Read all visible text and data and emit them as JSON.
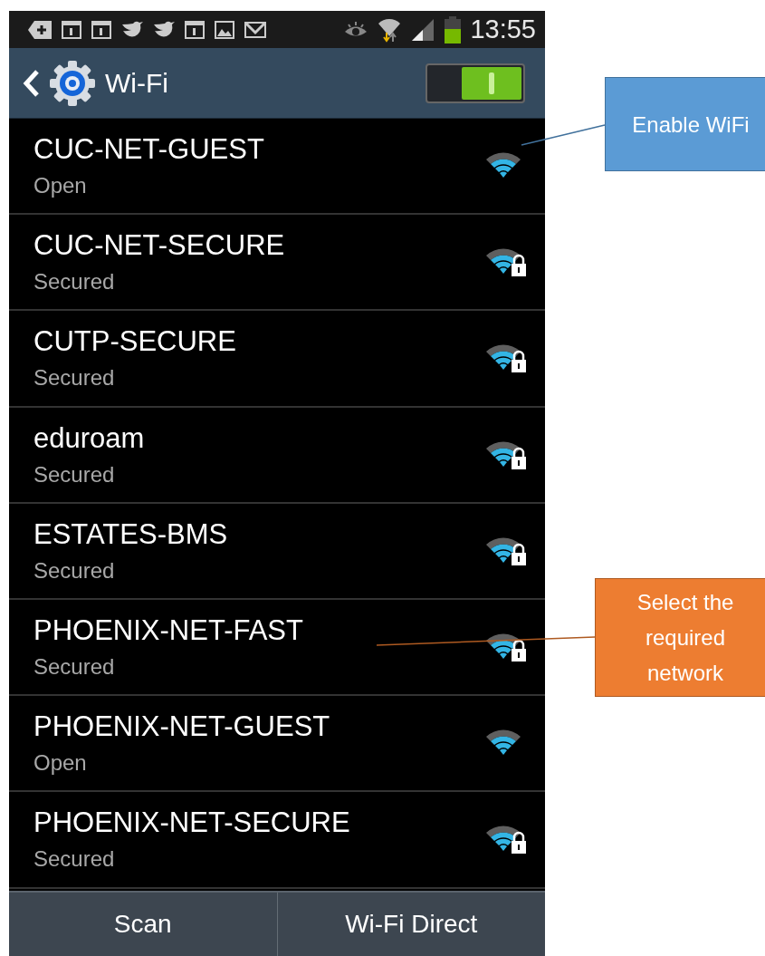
{
  "status_bar": {
    "time": "13:55"
  },
  "header": {
    "title": "Wi-Fi",
    "wifi_switch": {
      "on": true
    }
  },
  "networks": [
    {
      "name": "CUC-NET-GUEST",
      "security": "Open",
      "kind": "open"
    },
    {
      "name": "CUC-NET-SECURE",
      "security": "Secured",
      "kind": "locked"
    },
    {
      "name": "CUTP-SECURE",
      "security": "Secured",
      "kind": "locked"
    },
    {
      "name": "eduroam",
      "security": "Secured",
      "kind": "locked"
    },
    {
      "name": "ESTATES-BMS",
      "security": "Secured",
      "kind": "locked"
    },
    {
      "name": "PHOENIX-NET-FAST",
      "security": "Secured",
      "kind": "locked"
    },
    {
      "name": "PHOENIX-NET-GUEST",
      "security": "Open",
      "kind": "open"
    },
    {
      "name": "PHOENIX-NET-SECURE",
      "security": "Secured",
      "kind": "locked"
    }
  ],
  "bottom_buttons": [
    {
      "label": "Scan"
    },
    {
      "label": "Wi-Fi Direct"
    }
  ],
  "callouts": [
    {
      "text": "Enable WiFi",
      "color": "#5b9bd5"
    },
    {
      "text": "Select the required network",
      "color": "#ed7d31"
    }
  ]
}
